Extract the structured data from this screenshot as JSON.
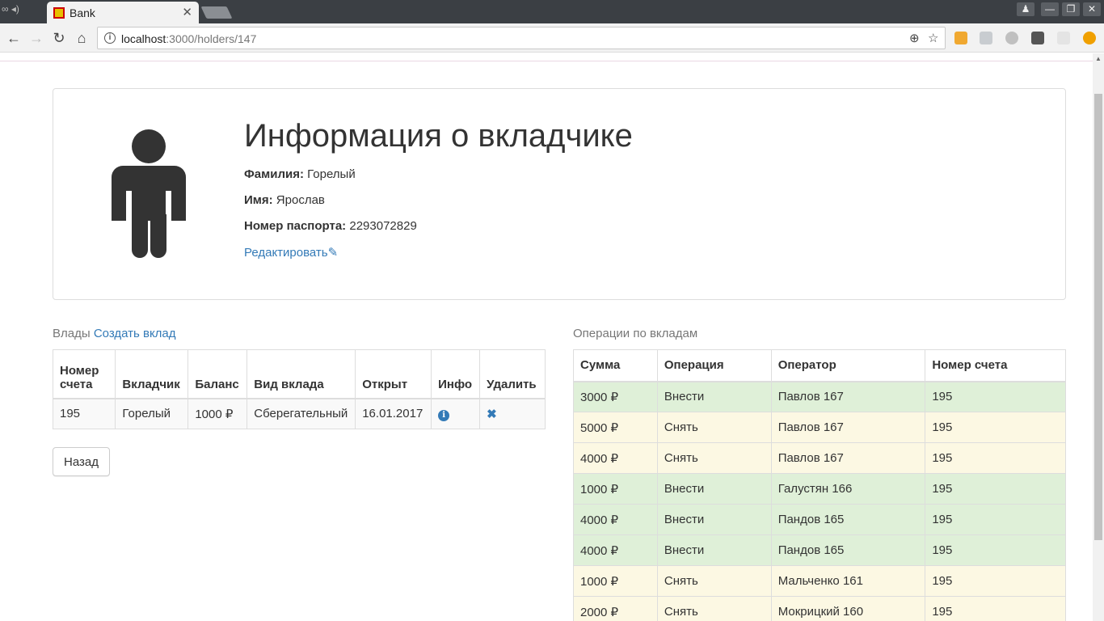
{
  "browser": {
    "tab_title": "Bank",
    "url_host": "localhost",
    "url_path": ":3000/holders/147"
  },
  "holder": {
    "heading": "Информация о вкладчике",
    "surname_label": "Фамилия:",
    "surname": "Горелый",
    "name_label": "Имя:",
    "name": "Ярослав",
    "passport_label": "Номер паспорта:",
    "passport": "2293072829",
    "edit_link": "Редактировать"
  },
  "deposits": {
    "caption": "Влады",
    "create_link": "Создать вклад",
    "headers": [
      "Номер счета",
      "Вкладчик",
      "Баланс",
      "Вид вклада",
      "Открыт",
      "Инфо",
      "Удалить"
    ],
    "rows": [
      {
        "account": "195",
        "holder": "Горелый",
        "balance": "1000 ₽",
        "type": "Сберегательный",
        "opened": "16.01.2017"
      }
    ],
    "back_button": "Назад"
  },
  "operations": {
    "caption": "Операции по вкладам",
    "headers": [
      "Сумма",
      "Операция",
      "Оператор",
      "Номер счета"
    ],
    "rows": [
      {
        "amount": "3000 ₽",
        "op": "Внести",
        "operator": "Павлов 167",
        "account": "195",
        "kind": "in"
      },
      {
        "amount": "5000 ₽",
        "op": "Снять",
        "operator": "Павлов 167",
        "account": "195",
        "kind": "out"
      },
      {
        "amount": "4000 ₽",
        "op": "Снять",
        "operator": "Павлов 167",
        "account": "195",
        "kind": "out"
      },
      {
        "amount": "1000 ₽",
        "op": "Внести",
        "operator": "Галустян 166",
        "account": "195",
        "kind": "in"
      },
      {
        "amount": "4000 ₽",
        "op": "Внести",
        "operator": "Пандов 165",
        "account": "195",
        "kind": "in"
      },
      {
        "amount": "4000 ₽",
        "op": "Внести",
        "operator": "Пандов 165",
        "account": "195",
        "kind": "in"
      },
      {
        "amount": "1000 ₽",
        "op": "Снять",
        "operator": "Мальченко 161",
        "account": "195",
        "kind": "out"
      },
      {
        "amount": "2000 ₽",
        "op": "Снять",
        "operator": "Мокрицкий 160",
        "account": "195",
        "kind": "out"
      }
    ]
  },
  "colors": {
    "deposit_row": "#dff0d8",
    "withdraw_row": "#fcf8e3",
    "link": "#337ab7"
  }
}
